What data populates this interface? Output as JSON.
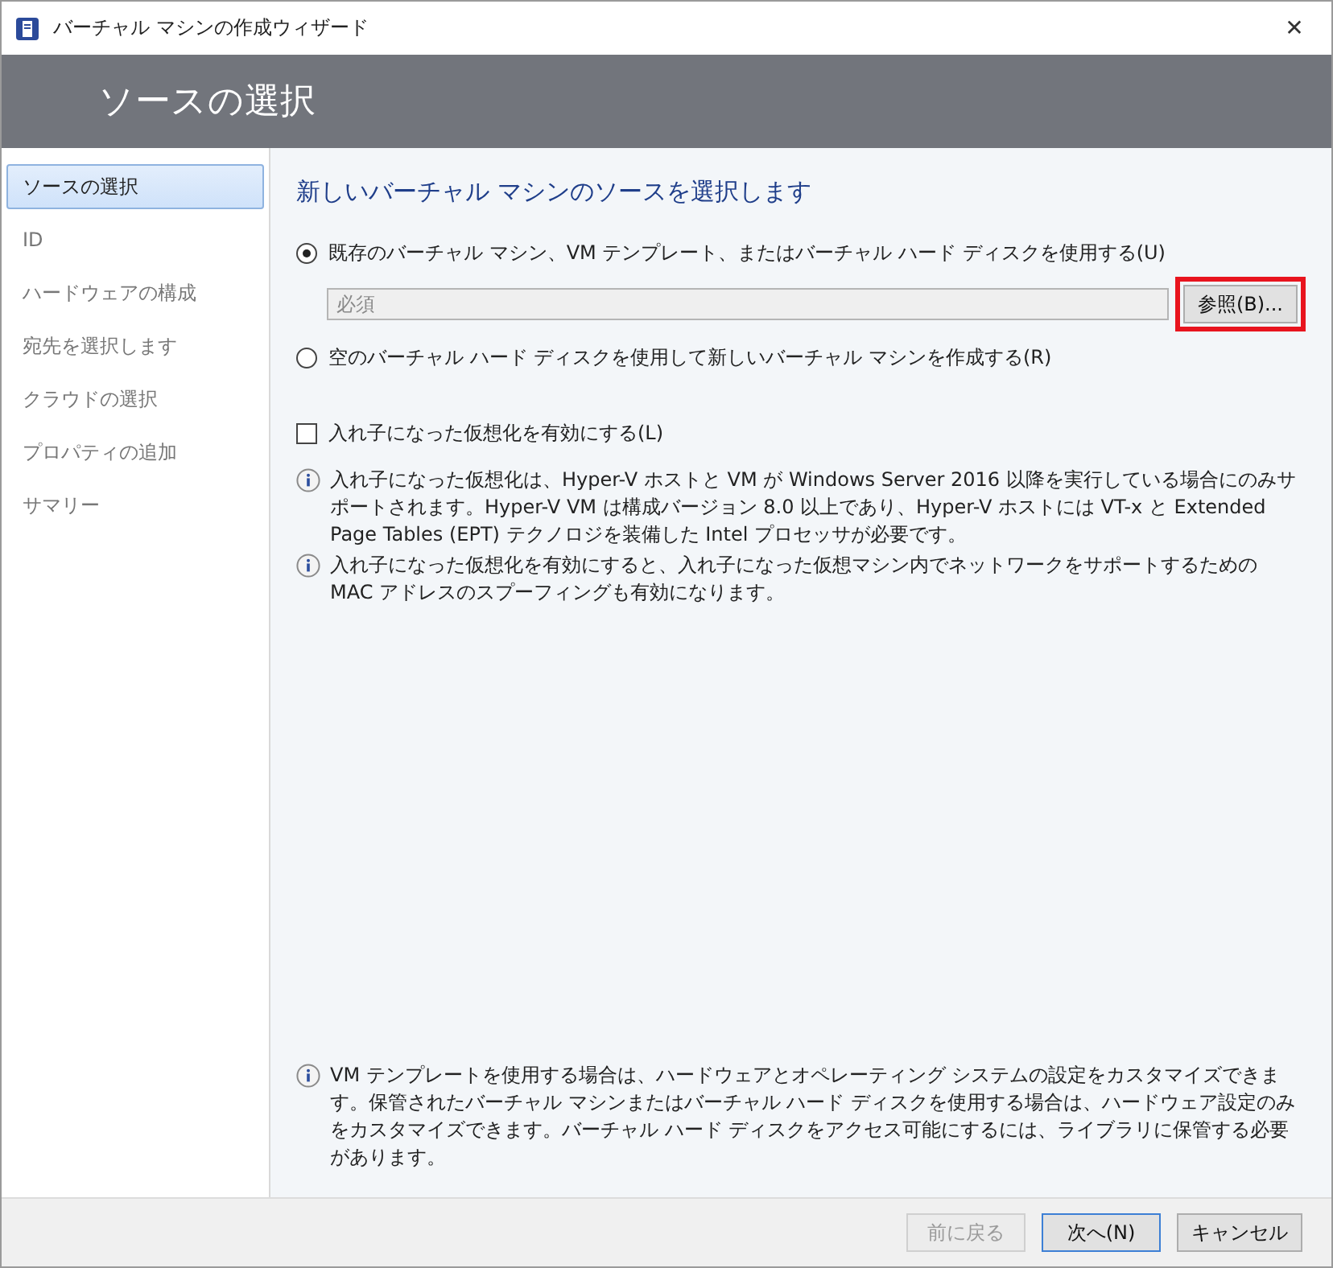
{
  "window": {
    "title": "バーチャル マシンの作成ウィザード",
    "close": "✕"
  },
  "header": {
    "title": "ソースの選択"
  },
  "sidebar": {
    "items": [
      {
        "label": "ソースの選択",
        "selected": true
      },
      {
        "label": "ID",
        "selected": false
      },
      {
        "label": "ハードウェアの構成",
        "selected": false
      },
      {
        "label": "宛先を選択します",
        "selected": false
      },
      {
        "label": "クラウドの選択",
        "selected": false
      },
      {
        "label": "プロパティの追加",
        "selected": false
      },
      {
        "label": "サマリー",
        "selected": false
      }
    ]
  },
  "content": {
    "heading": "新しいバーチャル マシンのソースを選択します",
    "options": [
      {
        "label": "既存のバーチャル マシン、VM テンプレート、またはバーチャル ハード ディスクを使用する(U)",
        "selected": true
      },
      {
        "label": "空のバーチャル ハード ディスクを使用して新しいバーチャル マシンを作成する(R)",
        "selected": false
      }
    ],
    "source_field": {
      "placeholder": "必須",
      "disabled": true
    },
    "browse_button": {
      "label": "参照(B)...",
      "highlighted": true
    },
    "nested_checkbox": {
      "label": "入れ子になった仮想化を有効にする(L)",
      "checked": false
    },
    "notes": [
      "入れ子になった仮想化は、Hyper-V ホストと VM が Windows Server 2016 以降を実行している場合にのみサポートされます。Hyper-V VM は構成バージョン 8.0 以上であり、Hyper-V ホストには VT-x と Extended Page Tables (EPT) テクノロジを装備した Intel プロセッサが必要です。",
      "入れ子になった仮想化を有効にすると、入れ子になった仮想マシン内でネットワークをサポートするための MAC アドレスのスプーフィングも有効になります。"
    ],
    "footer_note": "VM テンプレートを使用する場合は、ハードウェアとオペレーティング システムの設定をカスタマイズできます。保管されたバーチャル マシンまたはバーチャル ハード ディスクを使用する場合は、ハードウェア設定のみをカスタマイズできます。バーチャル ハード ディスクをアクセス可能にするには、ライブラリに保管する必要があります。"
  },
  "buttons": [
    {
      "label": "前に戻る",
      "disabled": true,
      "default": false
    },
    {
      "label": "次へ(N)",
      "disabled": false,
      "default": true
    },
    {
      "label": "キャンセル",
      "disabled": false,
      "default": false
    }
  ]
}
